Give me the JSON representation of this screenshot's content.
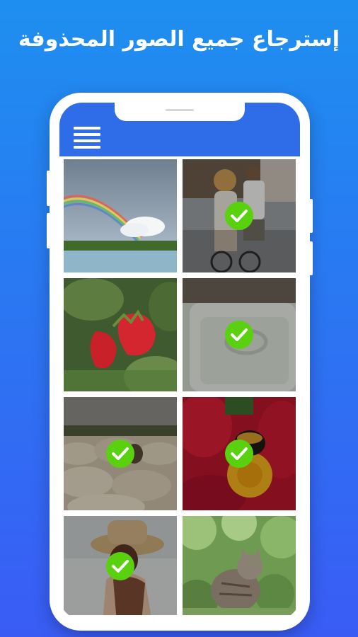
{
  "headline": "إسترجاع جميع الصور المحذوفة",
  "app": {
    "menu_icon": "hamburger-menu-icon",
    "accent_color": "#2f6de8",
    "check_color": "#5ad10f"
  },
  "photos": [
    {
      "subject": "rainbow-over-lake",
      "selected": false
    },
    {
      "subject": "cyclists-on-street",
      "selected": true
    },
    {
      "subject": "strawberries",
      "selected": false
    },
    {
      "subject": "ring-in-box",
      "selected": true
    },
    {
      "subject": "sheep-flock",
      "selected": true
    },
    {
      "subject": "bee-on-flower",
      "selected": true
    },
    {
      "subject": "woman-in-hat",
      "selected": true
    },
    {
      "subject": "cat-in-garden",
      "selected": false
    }
  ]
}
